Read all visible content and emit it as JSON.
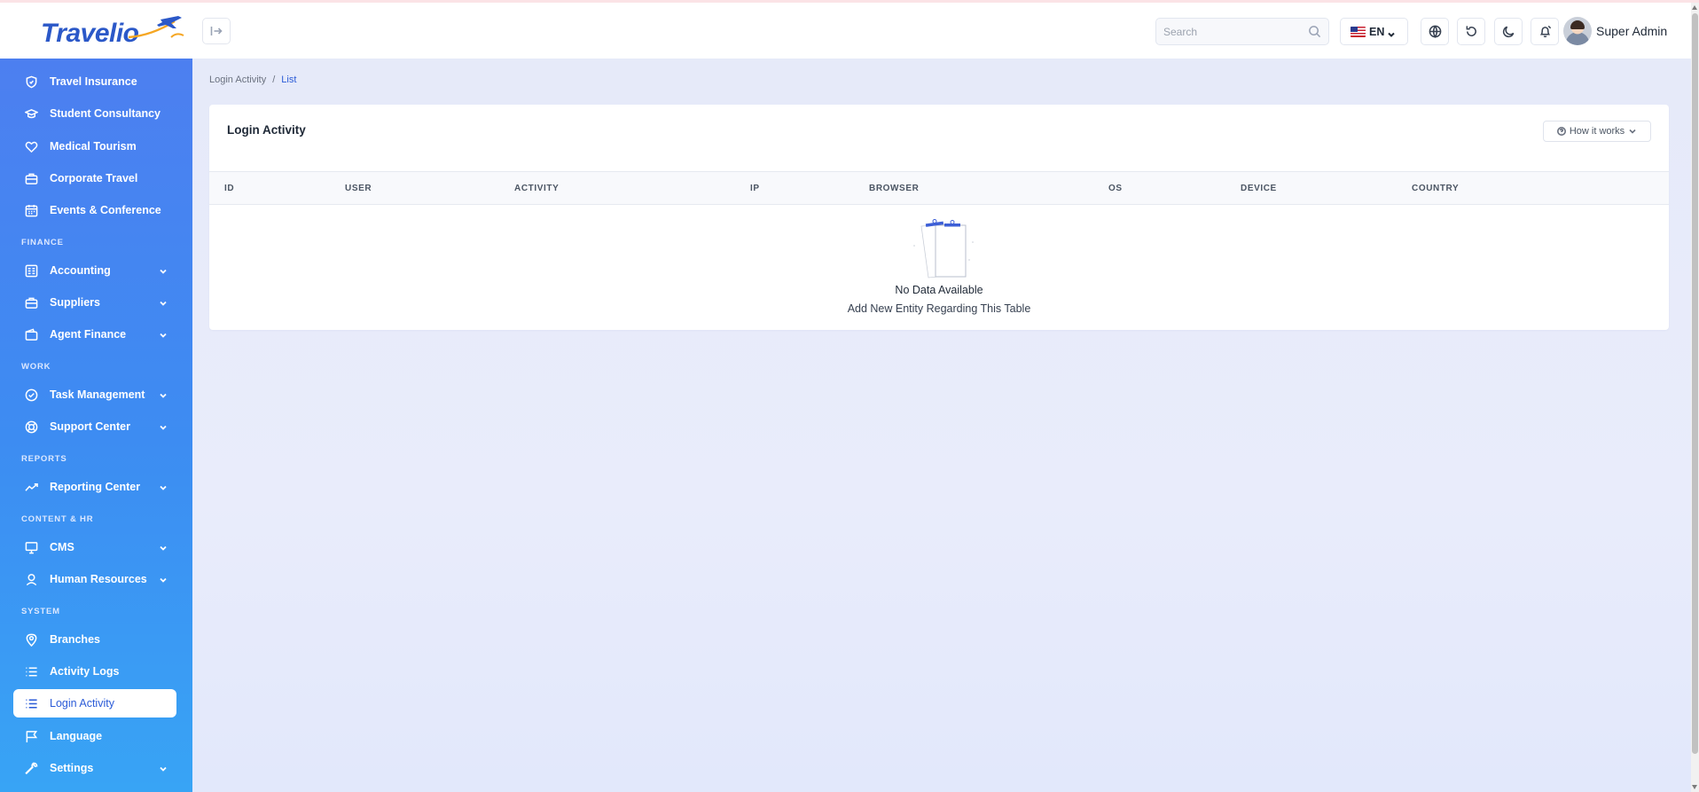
{
  "app": {
    "logo_text": "Travelio"
  },
  "sidebar": {
    "items_top": [
      {
        "label": "Travel Insurance",
        "icon": "shield-icon"
      },
      {
        "label": "Student Consultancy",
        "icon": "graduation-cap-icon"
      },
      {
        "label": "Medical Tourism",
        "icon": "heart-icon"
      },
      {
        "label": "Corporate Travel",
        "icon": "briefcase-icon"
      },
      {
        "label": "Events & Conference",
        "icon": "calendar-icon"
      }
    ],
    "sections": {
      "finance": "FINANCE",
      "work": "WORK",
      "reports": "REPORTS",
      "content_hr": "CONTENT & HR",
      "system": "SYSTEM"
    },
    "finance_items": [
      {
        "label": "Accounting",
        "icon": "ledger-icon",
        "expandable": true
      },
      {
        "label": "Suppliers",
        "icon": "briefcase-icon",
        "expandable": true
      },
      {
        "label": "Agent Finance",
        "icon": "wallet-icon",
        "expandable": true
      }
    ],
    "work_items": [
      {
        "label": "Task Management",
        "icon": "check-circle-icon",
        "expandable": true
      },
      {
        "label": "Support Center",
        "icon": "lifebuoy-icon",
        "expandable": true
      }
    ],
    "reports_items": [
      {
        "label": "Reporting Center",
        "icon": "trend-line-icon",
        "expandable": true
      }
    ],
    "content_items": [
      {
        "label": "CMS",
        "icon": "monitor-icon",
        "expandable": true
      },
      {
        "label": "Human Resources",
        "icon": "user-badge-icon",
        "expandable": true
      }
    ],
    "system_items": [
      {
        "label": "Branches",
        "icon": "map-pin-icon",
        "expandable": false
      },
      {
        "label": "Activity Logs",
        "icon": "list-icon",
        "expandable": false
      },
      {
        "label": "Login Activity",
        "icon": "list-icon",
        "expandable": false,
        "active": true
      },
      {
        "label": "Language",
        "icon": "flag-icon",
        "expandable": false
      },
      {
        "label": "Settings",
        "icon": "wrench-icon",
        "expandable": true
      }
    ]
  },
  "header": {
    "search_placeholder": "Search",
    "language_code": "EN",
    "user_name": "Super Admin"
  },
  "breadcrumb": {
    "parent": "Login Activity",
    "separator": "/",
    "current": "List"
  },
  "card": {
    "title": "Login Activity",
    "how_it_works": "How it works",
    "columns": [
      "ID",
      "USER",
      "ACTIVITY",
      "IP",
      "BROWSER",
      "OS",
      "DEVICE",
      "COUNTRY"
    ],
    "rows": [],
    "empty_title": "No Data Available",
    "empty_subtitle": "Add New Entity Regarding This Table"
  },
  "colors": {
    "sidebar_top": "#4f7df0",
    "sidebar_bottom": "#38a4f5",
    "accent": "#2b5bd7",
    "content_bg": "#e8ebfa"
  }
}
